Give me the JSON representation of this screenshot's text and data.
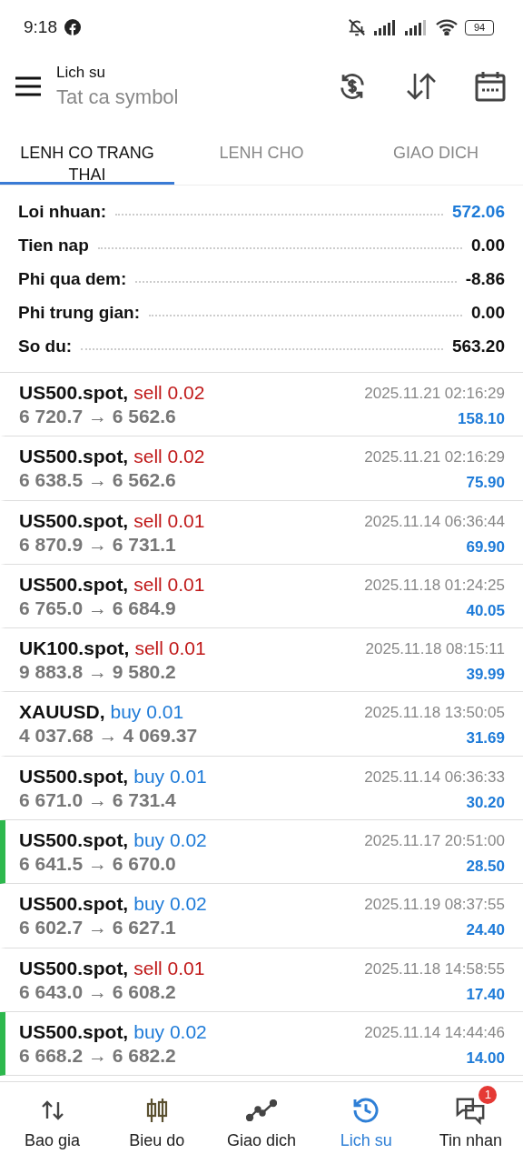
{
  "status_bar": {
    "time": "9:18",
    "battery": "94"
  },
  "header": {
    "title": "Lich su",
    "subtitle": "Tat ca symbol"
  },
  "tabs": [
    {
      "label": "LENH CO TRANG THAI",
      "selected": true
    },
    {
      "label": "LENH CHO",
      "selected": false
    },
    {
      "label": "GIAO DICH",
      "selected": false
    }
  ],
  "summary": [
    {
      "label": "Loi nhuan:",
      "value": "572.06",
      "highlight": true
    },
    {
      "label": "Tien nap",
      "value": "0.00",
      "highlight": false
    },
    {
      "label": "Phi qua dem:",
      "value": "-8.86",
      "highlight": false
    },
    {
      "label": "Phi trung gian:",
      "value": "0.00",
      "highlight": false
    },
    {
      "label": "So du:",
      "value": "563.20",
      "highlight": false
    }
  ],
  "deals": [
    {
      "symbol": "US500.spot,",
      "kind": "sell",
      "order": "sell 0.02",
      "prices": "6 720.7 → 6 562.6",
      "time": "2025.11.21 02:16:29",
      "profit": "158.10",
      "marked": false
    },
    {
      "symbol": "US500.spot,",
      "kind": "sell",
      "order": "sell 0.02",
      "prices": "6 638.5 → 6 562.6",
      "time": "2025.11.21 02:16:29",
      "profit": "75.90",
      "marked": false
    },
    {
      "symbol": "US500.spot,",
      "kind": "sell",
      "order": "sell 0.01",
      "prices": "6 870.9 → 6 731.1",
      "time": "2025.11.14 06:36:44",
      "profit": "69.90",
      "marked": false
    },
    {
      "symbol": "US500.spot,",
      "kind": "sell",
      "order": "sell 0.01",
      "prices": "6 765.0 → 6 684.9",
      "time": "2025.11.18 01:24:25",
      "profit": "40.05",
      "marked": false
    },
    {
      "symbol": "UK100.spot,",
      "kind": "sell",
      "order": "sell 0.01",
      "prices": "9 883.8 → 9 580.2",
      "time": "2025.11.18 08:15:11",
      "profit": "39.99",
      "marked": false
    },
    {
      "symbol": "XAUUSD,",
      "kind": "buy",
      "order": "buy 0.01",
      "prices": "4 037.68 → 4 069.37",
      "time": "2025.11.18 13:50:05",
      "profit": "31.69",
      "marked": false
    },
    {
      "symbol": "US500.spot,",
      "kind": "buy",
      "order": "buy 0.01",
      "prices": "6 671.0 → 6 731.4",
      "time": "2025.11.14 06:36:33",
      "profit": "30.20",
      "marked": false
    },
    {
      "symbol": "US500.spot,",
      "kind": "buy",
      "order": "buy 0.02",
      "prices": "6 641.5 → 6 670.0",
      "time": "2025.11.17 20:51:00",
      "profit": "28.50",
      "marked": true
    },
    {
      "symbol": "US500.spot,",
      "kind": "buy",
      "order": "buy 0.02",
      "prices": "6 602.7 → 6 627.1",
      "time": "2025.11.19 08:37:55",
      "profit": "24.40",
      "marked": false
    },
    {
      "symbol": "US500.spot,",
      "kind": "sell",
      "order": "sell 0.01",
      "prices": "6 643.0 → 6 608.2",
      "time": "2025.11.18 14:58:55",
      "profit": "17.40",
      "marked": false
    },
    {
      "symbol": "US500.spot,",
      "kind": "buy",
      "order": "buy 0.02",
      "prices": "6 668.2 → 6 682.2",
      "time": "2025.11.14 14:44:46",
      "profit": "14.00",
      "marked": true
    }
  ],
  "nav": [
    {
      "kind": "quotes",
      "label": "Bao gia",
      "selected": false
    },
    {
      "kind": "chart",
      "label": "Bieu do",
      "selected": false
    },
    {
      "kind": "trade",
      "label": "Giao dich",
      "selected": false
    },
    {
      "kind": "history",
      "label": "Lich su",
      "selected": true
    },
    {
      "kind": "messages",
      "label": "Tin nhan",
      "selected": false,
      "badge": "1"
    }
  ]
}
